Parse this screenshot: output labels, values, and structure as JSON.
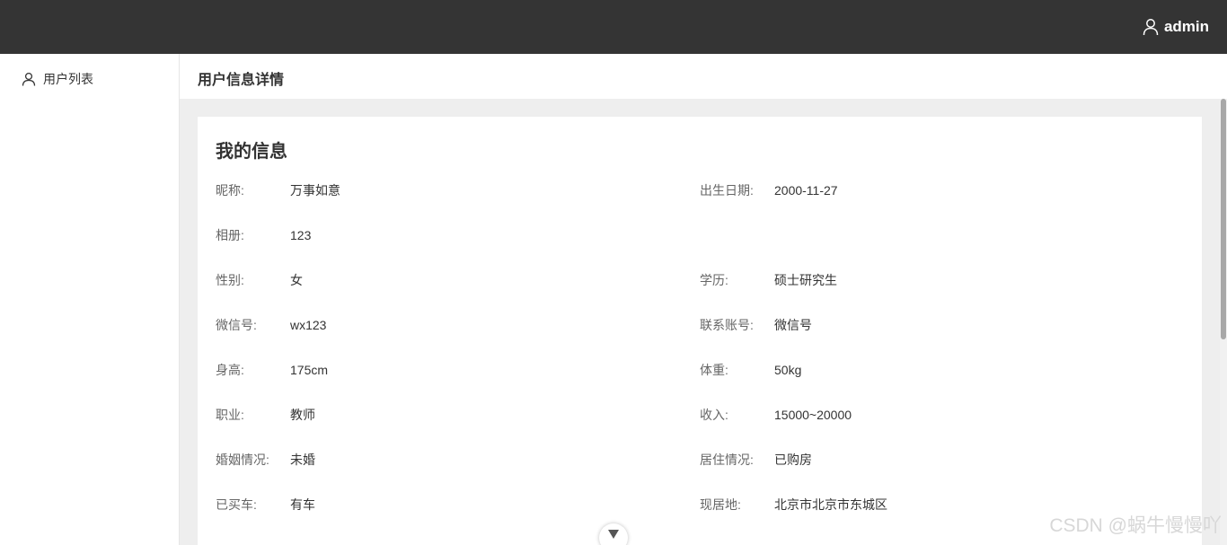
{
  "header": {
    "username": "admin"
  },
  "sidebar": {
    "items": [
      {
        "label": "用户列表",
        "icon": "user-icon"
      }
    ]
  },
  "page": {
    "title": "用户信息详情"
  },
  "card": {
    "title": "我的信息",
    "fields": [
      {
        "label": "昵称:",
        "value": "万事如意"
      },
      {
        "label": "出生日期:",
        "value": "2000-11-27"
      },
      {
        "label": "相册:",
        "value": "123"
      },
      {
        "label": "性别:",
        "value": "女"
      },
      {
        "label": "学历:",
        "value": "硕士研究生"
      },
      {
        "label": "微信号:",
        "value": "wx123"
      },
      {
        "label": "联系账号:",
        "value": "微信号"
      },
      {
        "label": "身高:",
        "value": "175cm"
      },
      {
        "label": "体重:",
        "value": "50kg"
      },
      {
        "label": "职业:",
        "value": "教师"
      },
      {
        "label": "收入:",
        "value": "15000~20000"
      },
      {
        "label": "婚姻情况:",
        "value": "未婚"
      },
      {
        "label": "居住情况:",
        "value": "已购房"
      },
      {
        "label": "已买车:",
        "value": "有车"
      },
      {
        "label": "现居地:",
        "value": "北京市北京市东城区"
      }
    ]
  },
  "watermark": "CSDN @蜗牛慢慢吖",
  "colors": {
    "topbar": "#343434",
    "background": "#eeeeee",
    "card": "#ffffff"
  }
}
